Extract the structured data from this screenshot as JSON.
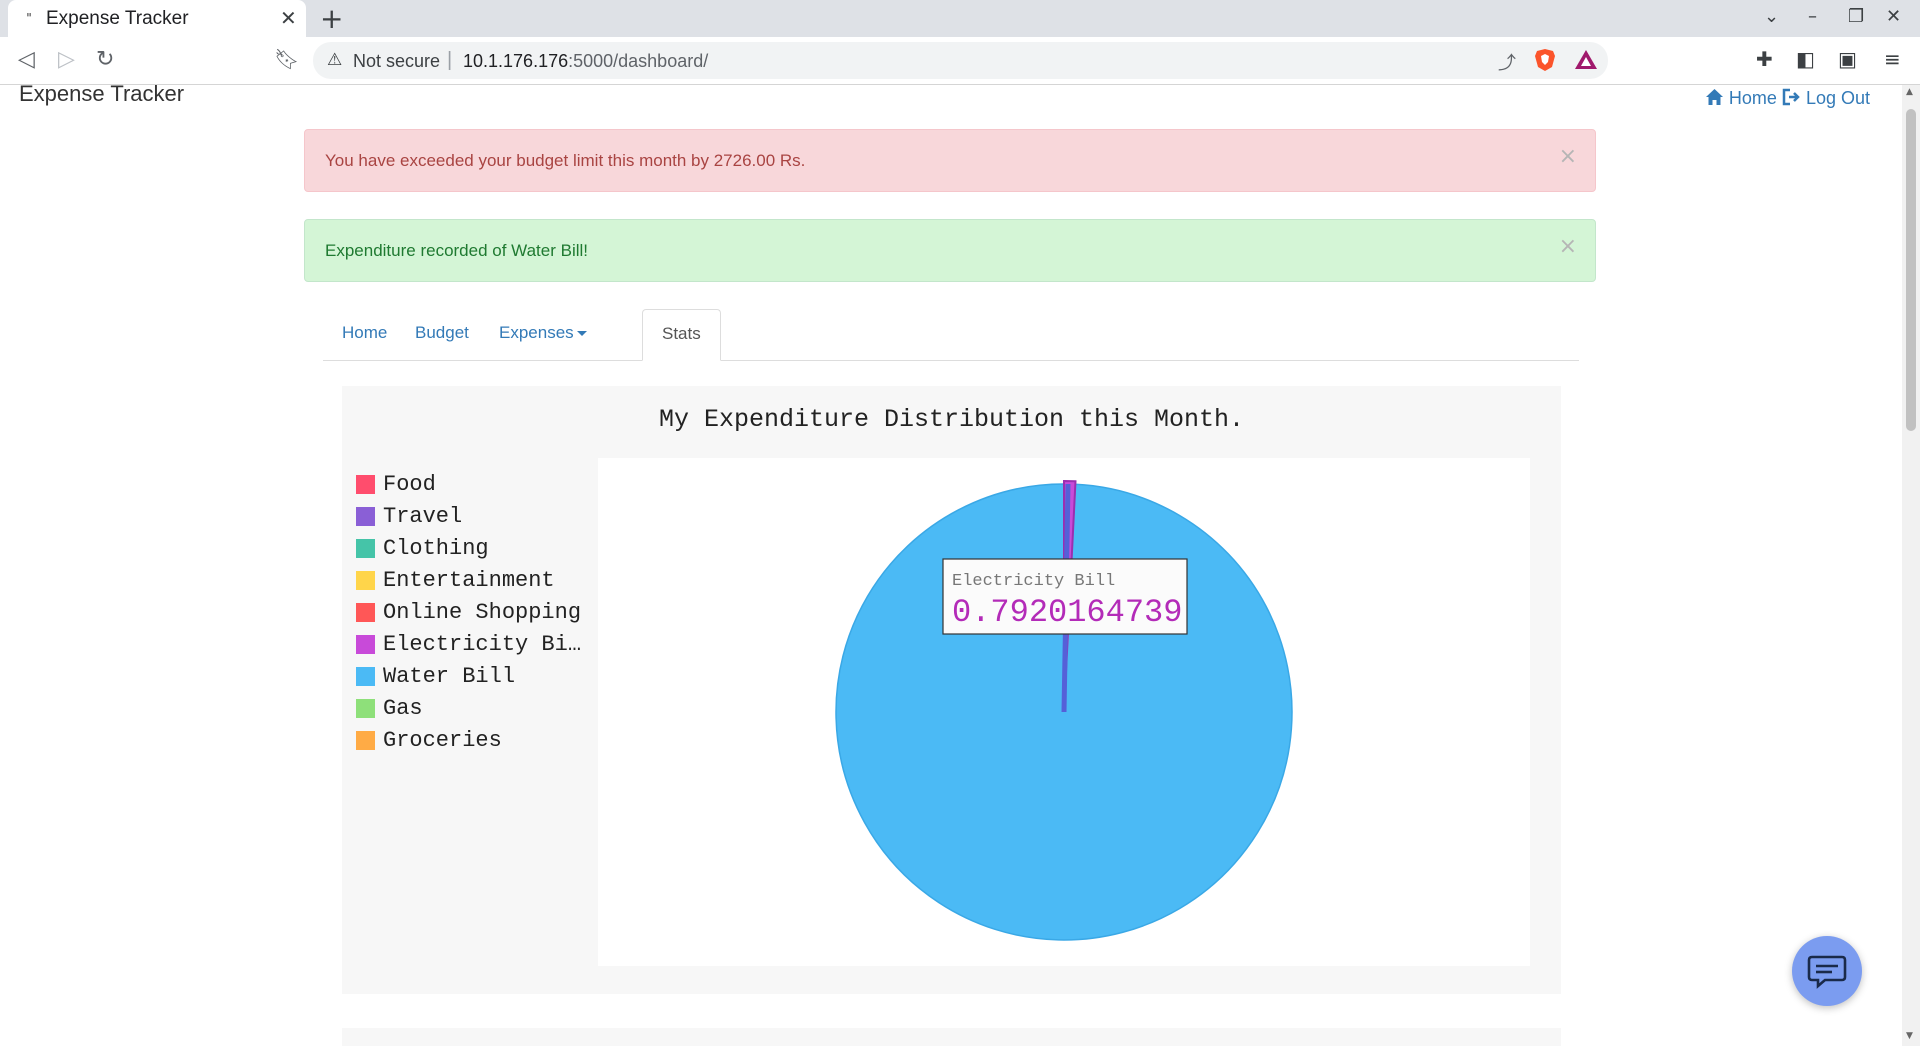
{
  "browser": {
    "tab_title": "Expense Tracker",
    "tab_favicon": "\"",
    "close_glyph": "✕",
    "newtab_glyph": "+",
    "security_label": "Not secure",
    "url_host": "10.1.176.176",
    "url_rest": ":5000/dashboard/"
  },
  "page": {
    "brand": "Expense Tracker",
    "topnav": {
      "home": "Home",
      "logout": "Log Out"
    },
    "alerts": [
      {
        "type": "danger",
        "text": "You have exceeded your budget limit this month by 2726.00 Rs."
      },
      {
        "type": "success",
        "text": "Expenditure recorded of Water Bill!"
      }
    ],
    "close_glyph": "×",
    "tabs": [
      {
        "label": "Home",
        "active": false
      },
      {
        "label": "Budget",
        "active": false
      },
      {
        "label": "Expenses",
        "active": false,
        "dropdown": true
      },
      {
        "label": "Stats",
        "active": true
      }
    ]
  },
  "chart_data": {
    "type": "pie",
    "title": "My Expenditure Distribution this Month.",
    "legend_position": "left",
    "series": [
      {
        "name": "Food",
        "color": "#ff4d6d"
      },
      {
        "name": "Travel",
        "color": "#8a5fd6"
      },
      {
        "name": "Clothing",
        "color": "#45c4a8"
      },
      {
        "name": "Entertainment",
        "color": "#ffd54a"
      },
      {
        "name": "Online Shopping",
        "color": "#ff5757"
      },
      {
        "name": "Electricity Bi…",
        "color": "#c84ad9"
      },
      {
        "name": "Water Bill",
        "color": "#4bbaf5"
      },
      {
        "name": "Gas",
        "color": "#8ee07a"
      },
      {
        "name": "Groceries",
        "color": "#ffab45"
      }
    ],
    "slices": [
      {
        "name": "Electricity Bill",
        "value": 0.7920164739,
        "color": "#c84ad9"
      },
      {
        "name": "Water Bill",
        "value": 99.2079835261,
        "color": "#4bbaf5"
      }
    ],
    "tooltip": {
      "label": "Electricity Bill",
      "value": "0.7920164739"
    }
  },
  "icons": {
    "home": "home-icon",
    "logout": "logout-icon",
    "chat": "chat-icon"
  }
}
